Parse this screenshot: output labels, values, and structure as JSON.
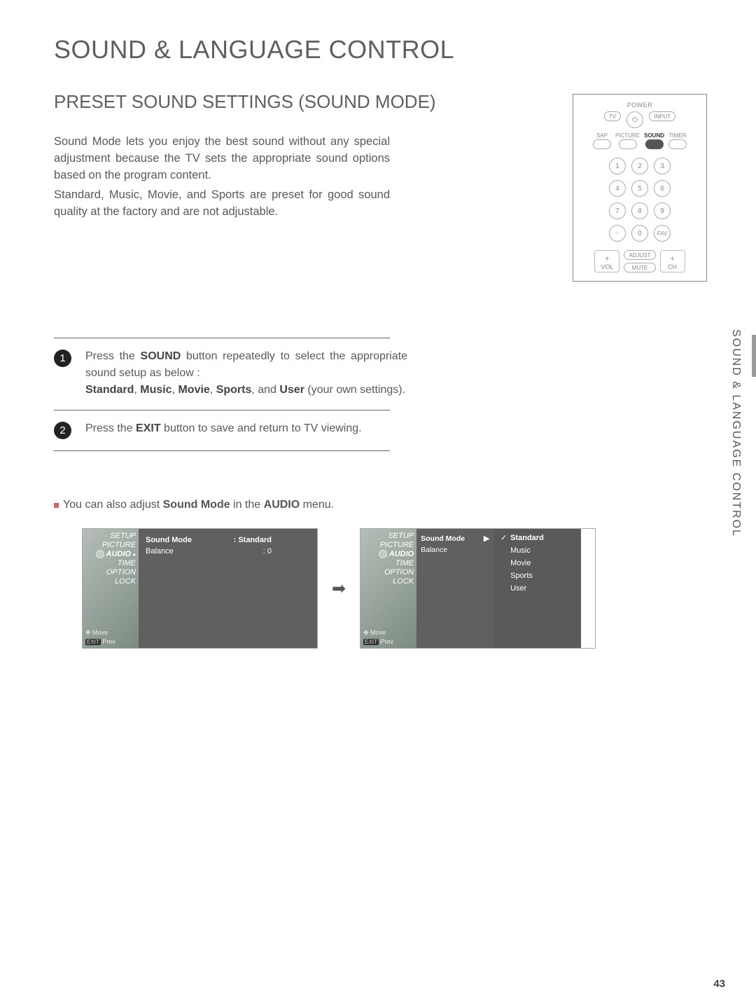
{
  "page": {
    "title": "SOUND & LANGUAGE CONTROL",
    "subtitle": "PRESET SOUND SETTINGS (SOUND MODE)",
    "intro1": "Sound Mode lets you enjoy the best sound without any special adjustment because the TV sets the appropriate sound options based on the program content.",
    "intro2": "Standard, Music, Movie, and Sports are preset for good sound quality at the factory and are not adjustable.",
    "side_label": "SOUND & LANGUAGE CONTROL",
    "page_number": "43"
  },
  "steps": {
    "s1_pre": "Press the ",
    "s1_bold": "SOUND",
    "s1_mid": " button repeatedly to select the appropriate sound setup as below :",
    "s1_modes_prefix": "",
    "s1_m1": "Standard",
    "s1_m2": "Music",
    "s1_m3": "Movie",
    "s1_m4": "Sports",
    "s1_and": ", and ",
    "s1_m5": "User",
    "s1_tail": " (your own settings).",
    "s2_pre": "Press the ",
    "s2_bold": "EXIT",
    "s2_post": " button to save and return to TV viewing."
  },
  "note": {
    "pre": "You can also adjust ",
    "bold": "Sound Mode",
    "mid": " in the ",
    "menu": "AUDIO",
    "post": " menu."
  },
  "remote": {
    "power": "POWER",
    "tv": "TV",
    "input": "INPUT",
    "modes": [
      "SAP",
      "PICTURE",
      "SOUND",
      "TIMER"
    ],
    "nums": [
      "1",
      "2",
      "3",
      "4",
      "5",
      "6",
      "7",
      "8",
      "9",
      "-",
      "0",
      "FAV"
    ],
    "vol": "VOL",
    "ch": "CH",
    "adjust": "ADJUST",
    "mute": "MUTE"
  },
  "osd": {
    "menu_items": [
      "SETUP",
      "PICTURE",
      "AUDIO",
      "TIME",
      "OPTION",
      "LOCK"
    ],
    "move": "Move",
    "prev": "Prev",
    "kv1_k": "Sound Mode",
    "kv1_v": ": Standard",
    "kv2_k": "Balance",
    "kv2_v": ": 0",
    "sm_label": "Sound Mode",
    "bal_label": "Balance",
    "arrow": "▶",
    "options": [
      "Standard",
      "Music",
      "Movie",
      "Sports",
      "User"
    ]
  }
}
